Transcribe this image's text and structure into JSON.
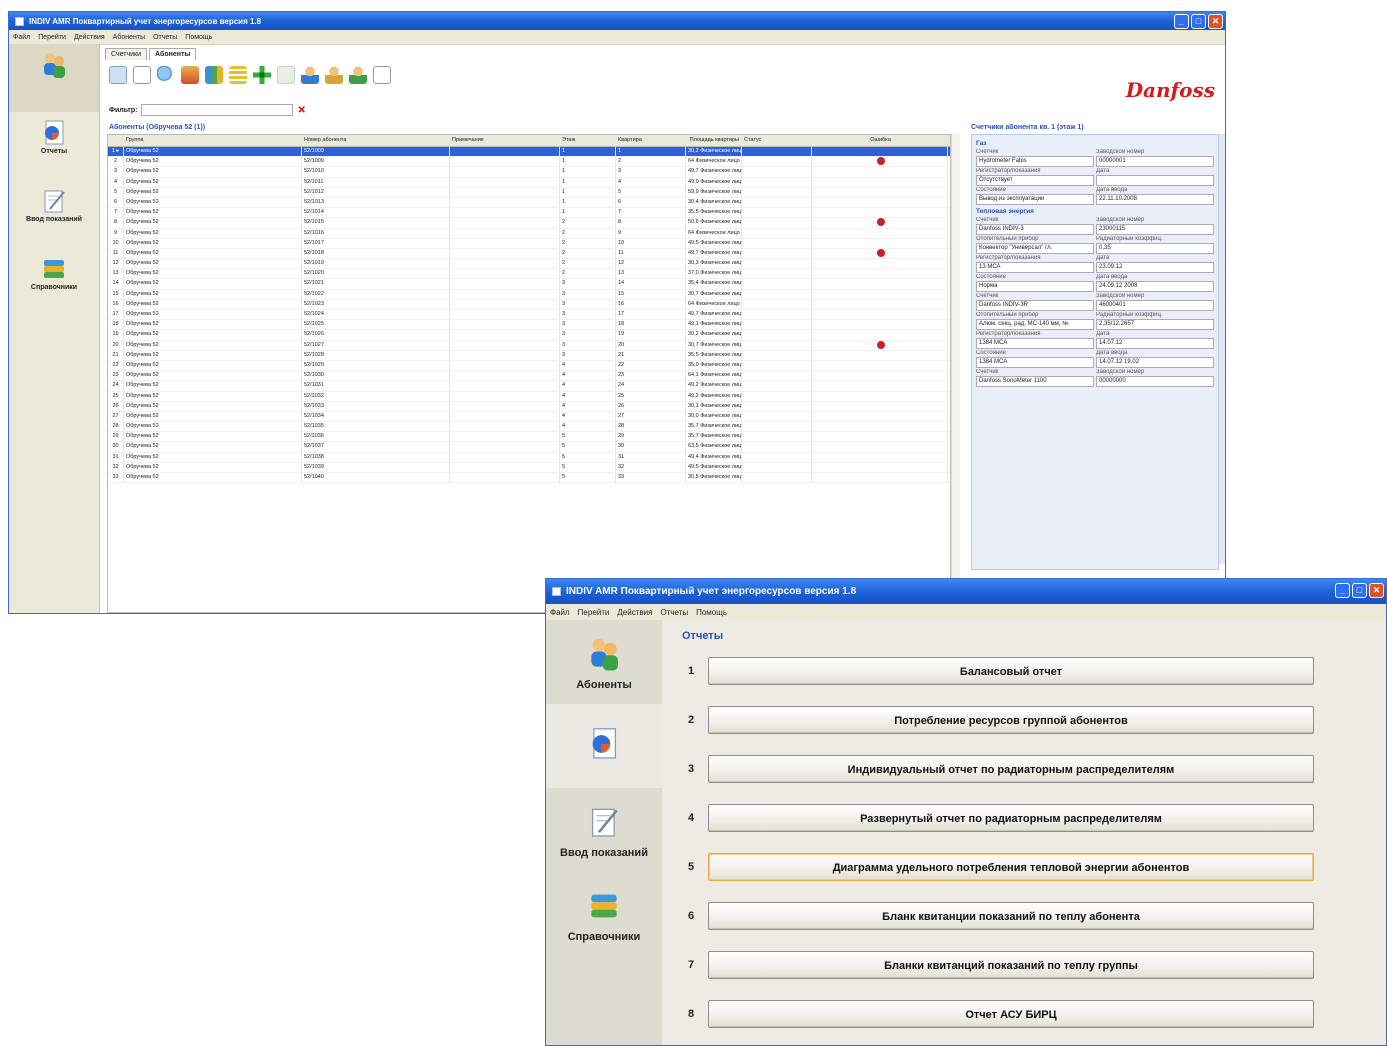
{
  "win1": {
    "title": "INDIV AMR Поквартирный учет энергоресурсов версия 1.8",
    "menu": [
      "Файл",
      "Перейти",
      "Действия",
      "Абоненты",
      "Отчеты",
      "Помощь"
    ],
    "sidebar": [
      {
        "label": ""
      },
      {
        "label": "Отчеты"
      },
      {
        "label": "Ввод показаний"
      },
      {
        "label": "Справочники"
      }
    ],
    "tabs": [
      "Счетчики",
      "Абоненты"
    ],
    "logo": "Danfoss",
    "filter_label": "Фильтр:",
    "filter_clear": "✕",
    "grid_title": "Абоненты (Обручева 52 (1))",
    "columns": [
      "",
      "Группа",
      "Номер абонента",
      "Примечание",
      "Этаж",
      "Квартира",
      "Площадь квартиры",
      "Статус",
      "Ошибка"
    ],
    "rows": [
      [
        "1 ▸",
        "Обручева 52",
        "52/1009",
        "",
        "1",
        "1",
        "30,2 Физическое лицо",
        ""
      ],
      [
        "2",
        "Обручева 52",
        "52/1009",
        "",
        "1",
        "2",
        "64 Физическое лицо",
        "●"
      ],
      [
        "3",
        "Обручева 52",
        "52/1010",
        "",
        "1",
        "3",
        "49,7 Физическое лицо",
        ""
      ],
      [
        "4",
        "Обручева 52",
        "52/1011",
        "",
        "1",
        "4",
        "49,0 Физическое лицо",
        ""
      ],
      [
        "5",
        "Обручева 52",
        "52/1012",
        "",
        "1",
        "5",
        "59,9 Физическое лицо",
        ""
      ],
      [
        "6",
        "Обручева 52",
        "52/1013",
        "",
        "1",
        "6",
        "30,4 Физическое лицо",
        ""
      ],
      [
        "7",
        "Обручева 52",
        "52/1014",
        "",
        "1",
        "7",
        "35,5 Физическое лицо",
        ""
      ],
      [
        "8",
        "Обручева 52",
        "52/1015",
        "",
        "2",
        "8",
        "50,6 Физическое лицо",
        "●"
      ],
      [
        "9",
        "Обручева 52",
        "52/1016",
        "",
        "2",
        "9",
        "64 Физическое лицо",
        ""
      ],
      [
        "10",
        "Обручева 52",
        "52/1017",
        "",
        "2",
        "10",
        "49,5 Физическое лицо",
        ""
      ],
      [
        "11",
        "Обручева 52",
        "52/1018",
        "",
        "2",
        "11",
        "49,7 Физическое лицо",
        "●"
      ],
      [
        "12",
        "Обручева 52",
        "52/1019",
        "",
        "2",
        "12",
        "30,3 Физическое лицо",
        ""
      ],
      [
        "13",
        "Обручева 52",
        "52/1020",
        "",
        "2",
        "13",
        "37,0 Физическое лицо",
        ""
      ],
      [
        "14",
        "Обручева 52",
        "52/1021",
        "",
        "3",
        "14",
        "35,4 Физическое лицо",
        ""
      ],
      [
        "15",
        "Обручева 52",
        "52/1022",
        "",
        "3",
        "15",
        "30,7 Физическое лицо",
        ""
      ],
      [
        "16",
        "Обручева 52",
        "52/1023",
        "",
        "3",
        "16",
        "64 Физическое лицо",
        ""
      ],
      [
        "17",
        "Обручева 52",
        "52/1024",
        "",
        "3",
        "17",
        "49,7 Физическое лицо",
        ""
      ],
      [
        "18",
        "Обручева 52",
        "52/1025",
        "",
        "3",
        "18",
        "49,1 Физическое лицо",
        ""
      ],
      [
        "19",
        "Обручева 52",
        "52/1026",
        "",
        "3",
        "19",
        "30,2 Физическое лицо",
        ""
      ],
      [
        "20",
        "Обручева 52",
        "52/1027",
        "",
        "3",
        "20",
        "30,7 Физическое лицо",
        "●"
      ],
      [
        "21",
        "Обручева 52",
        "52/1028",
        "",
        "3",
        "21",
        "35,5 Физическое лицо",
        ""
      ],
      [
        "22",
        "Обручева 52",
        "52/1029",
        "",
        "4",
        "22",
        "35,0 Физическое лицо",
        ""
      ],
      [
        "23",
        "Обручева 52",
        "52/1030",
        "",
        "4",
        "23",
        "64,1 Физическое лицо",
        ""
      ],
      [
        "24",
        "Обручева 52",
        "52/1031",
        "",
        "4",
        "24",
        "49,2 Физическое лицо",
        ""
      ],
      [
        "25",
        "Обручева 52",
        "52/1032",
        "",
        "4",
        "25",
        "49,2 Физическое лицо",
        ""
      ],
      [
        "26",
        "Обручева 52",
        "52/1033",
        "",
        "4",
        "26",
        "30,1 Физическое лицо",
        ""
      ],
      [
        "27",
        "Обручева 52",
        "52/1034",
        "",
        "4",
        "27",
        "30,0 Физическое лицо",
        ""
      ],
      [
        "28",
        "Обручева 52",
        "52/1035",
        "",
        "4",
        "28",
        "35,7 Физическое лицо",
        ""
      ],
      [
        "29",
        "Обручева 52",
        "52/1036",
        "",
        "5",
        "29",
        "35,7 Физическое лицо",
        ""
      ],
      [
        "30",
        "Обручева 52",
        "52/1037",
        "",
        "5",
        "30",
        "63,5 Физическое лицо",
        ""
      ],
      [
        "31",
        "Обручева 52",
        "52/1038",
        "",
        "5",
        "31",
        "49,4 Физическое лицо",
        ""
      ],
      [
        "32",
        "Обручева 52",
        "52/1039",
        "",
        "5",
        "32",
        "49,5 Физическое лицо",
        ""
      ],
      [
        "33",
        "Обручева 52",
        "52/1040",
        "",
        "5",
        "33",
        "30,5 Физическое лицо",
        ""
      ]
    ],
    "panel": {
      "title": "Счетчики абонента кв. 1 (этаж 1)",
      "sec_gas": "Газ",
      "gas": [
        [
          "Счетчик",
          "Заводской номер",
          "Hydrometer Fabis",
          "00000001"
        ],
        [
          "Регистратор/показания",
          "Дата",
          "Отсутствует",
          ""
        ],
        [
          "Состояние",
          "Дата ввода",
          "Вывод из эксплуатации",
          "22.11.10.2008"
        ]
      ],
      "sec_heat": "Тепловая энергия",
      "heat": [
        [
          "Счетчик",
          "Заводской номер",
          "Danfoss INDIV-3",
          "23000115"
        ],
        [
          "Отопительный прибор",
          "Радиаторный коэффиц.",
          "Конвектор \"Универсал\" гл.",
          "0,35"
        ],
        [
          "Регистратор/показания",
          "Дата",
          "13 МСА",
          "23.09.12"
        ],
        [
          "Состояние",
          "Дата ввода",
          "Норма",
          "24.09.12 2008"
        ],
        [
          "Счетчик",
          "Заводской номер",
          "Danfoss INDIV-3R",
          "46000401"
        ],
        [
          "Отопительный прибор",
          "Радиаторный коэффиц.",
          "Алюм. секц. рад. МС-140 мм, №",
          "2,35/12,2657"
        ],
        [
          "Регистратор/показания",
          "Дата",
          "1384 МСА",
          "14.07.12"
        ],
        [
          "Состояние",
          "Дата ввода",
          "1384 МСА",
          "14.07.12 19.02"
        ],
        [
          "Счетчик",
          "Заводской номер",
          "Danfoss SonoMeter 1100",
          "00000000"
        ]
      ]
    }
  },
  "win2": {
    "title": "INDIV AMR Поквартирный учет энергоресурсов версия 1.8",
    "menu": [
      "Файл",
      "Перейти",
      "Действия",
      "Отчеты",
      "Помощь"
    ],
    "sidebar": [
      {
        "label": "Абоненты"
      },
      {
        "label": ""
      },
      {
        "label": "Ввод показаний"
      },
      {
        "label": "Справочники"
      }
    ],
    "main_title": "Отчеты",
    "reports": [
      {
        "num": "1",
        "label": "Балансовый отчет"
      },
      {
        "num": "2",
        "label": "Потребление ресурсов группой абонентов"
      },
      {
        "num": "3",
        "label": "Индивидуальный отчет по радиаторным распределителям"
      },
      {
        "num": "4",
        "label": "Развернутый отчет по радиаторным распределителям"
      },
      {
        "num": "5",
        "label": "Диаграмма удельного потребления тепловой энергии абонентов"
      },
      {
        "num": "6",
        "label": "Бланк квитанции показаний по теплу абонента"
      },
      {
        "num": "7",
        "label": "Бланки квитанций показаний по теплу группы"
      },
      {
        "num": "8",
        "label": "Отчет АСУ БИРЦ"
      }
    ]
  },
  "colors": {
    "titlebar": "#1d5fd6",
    "accent": "#2a4fbf",
    "logo": "#d61a1a",
    "error": "#cc2020"
  }
}
